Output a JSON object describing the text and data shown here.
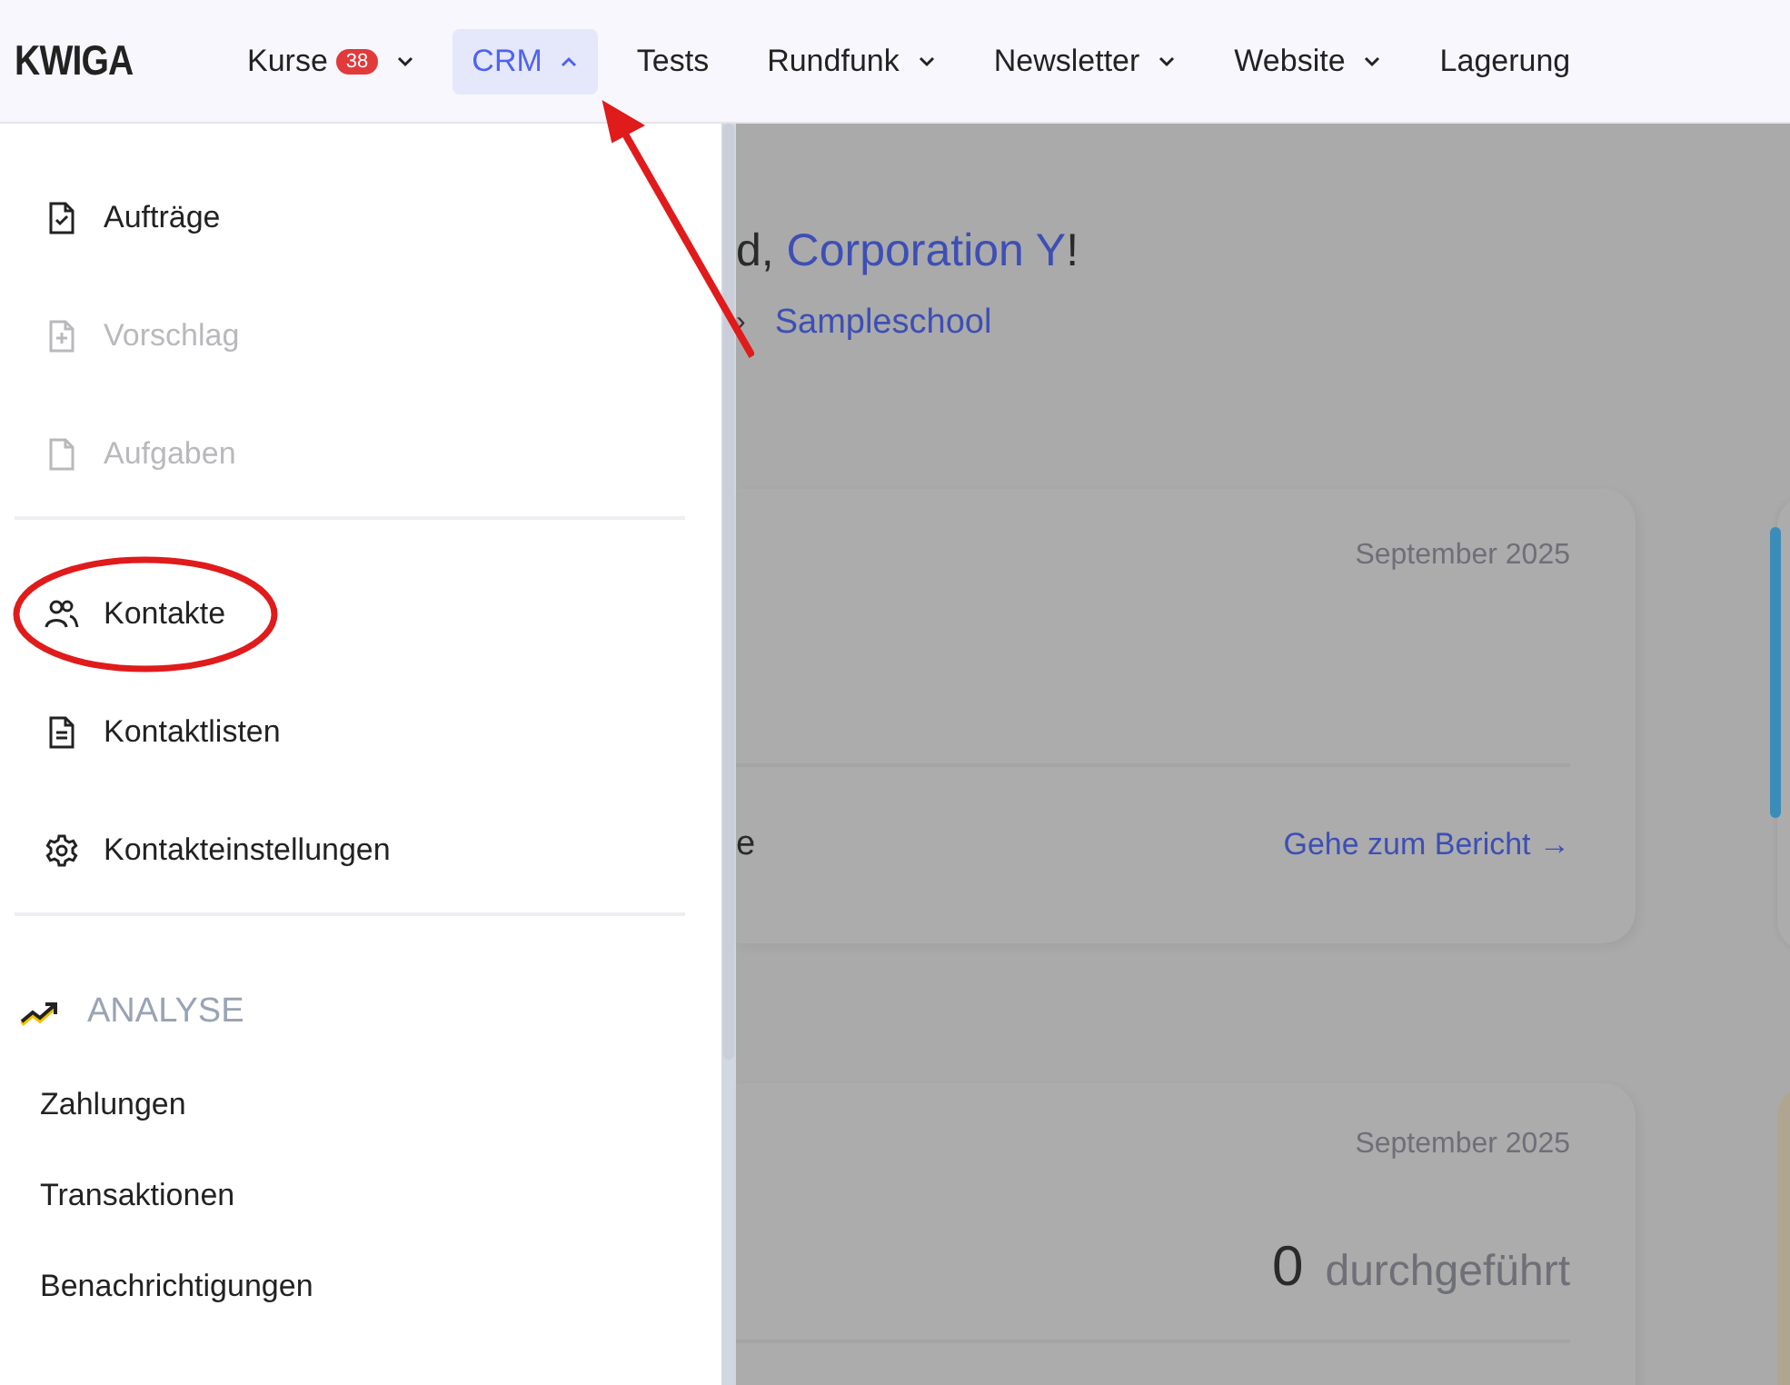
{
  "header": {
    "logo": "KWIGA",
    "nav": [
      {
        "label": "Kurse",
        "badge": "38",
        "dropdown": true,
        "expanded": false,
        "selected": false
      },
      {
        "label": "CRM",
        "dropdown": true,
        "expanded": true,
        "selected": true
      },
      {
        "label": "Tests",
        "dropdown": false,
        "selected": false
      },
      {
        "label": "Rundfunk",
        "dropdown": true,
        "expanded": false,
        "selected": false
      },
      {
        "label": "Newsletter",
        "dropdown": true,
        "expanded": false,
        "selected": false
      },
      {
        "label": "Website",
        "dropdown": true,
        "expanded": false,
        "selected": false
      },
      {
        "label": "Lagerung",
        "dropdown": false,
        "selected": false
      }
    ]
  },
  "menu": {
    "groups": [
      {
        "items": [
          {
            "label": "Aufträge",
            "disabled": false
          },
          {
            "label": "Vorschlag",
            "disabled": true
          },
          {
            "label": "Aufgaben",
            "disabled": true
          }
        ]
      },
      {
        "items": [
          {
            "label": "Kontakte",
            "disabled": false,
            "highlighted": true
          },
          {
            "label": "Kontaktlisten",
            "disabled": false,
            "highlighted": false
          },
          {
            "label": "Kontakteinstellungen",
            "disabled": false,
            "highlighted": false
          }
        ]
      }
    ],
    "section": {
      "title": "ANALYSE",
      "items": [
        "Zahlungen",
        "Transaktionen",
        "Benachrichtigungen"
      ]
    }
  },
  "main": {
    "greeting": {
      "start": "d,",
      "name": "Corporation Y",
      "end": "!"
    },
    "breadcrumb": {
      "separator": "›",
      "link": "Sampleschool"
    },
    "cards": [
      {
        "period": "September 2025",
        "footer_text": "e",
        "link": "Gehe zum Bericht →"
      },
      {
        "period": "September 2025",
        "count": "0",
        "count_label": "durchgeführt"
      }
    ]
  }
}
